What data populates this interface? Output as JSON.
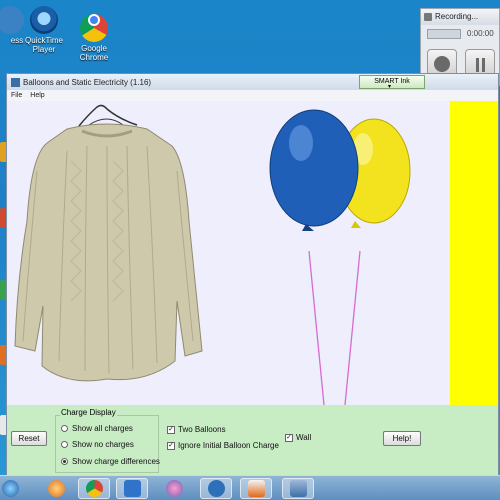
{
  "desktop": {
    "icons": [
      {
        "label_line1": "ess",
        "label_line2": "",
        "icon": "partial-app-icon"
      },
      {
        "label_line1": "QuickTime",
        "label_line2": "Player",
        "icon": "quicktime-icon"
      },
      {
        "label_line1": "Google",
        "label_line2": "Chrome",
        "icon": "chrome-icon"
      }
    ]
  },
  "window": {
    "title": "Balloons and Static Electricity (1.16)",
    "smart_ink_label": "SMART Ink",
    "menu": [
      "File",
      "Help"
    ]
  },
  "controls": {
    "reset_label": "Reset",
    "charge_display": {
      "title": "Charge Display",
      "options": [
        "Show all charges",
        "Show no charges",
        "Show charge differences"
      ],
      "selected": "Show charge differences"
    },
    "two_balloons": {
      "label": "Two Balloons",
      "checked": true
    },
    "ignore_initial": {
      "label": "Ignore Initial Balloon Charge",
      "checked": true
    },
    "wall": {
      "label": "Wall",
      "checked": true
    },
    "help_label": "Help!"
  },
  "recorder": {
    "title": "Recording...",
    "time": "0:00:00"
  },
  "colors": {
    "balloon_blue": "#1f5fb8",
    "balloon_yellow": "#f2e31e",
    "wall": "#ffff00",
    "control_panel": "#c8ecc4",
    "sim_background": "#eeeefc"
  },
  "taskbar": {
    "items": [
      "start-icon",
      "media-player-icon",
      "chrome-icon",
      "smart-notebook-icon",
      "network-icon",
      "user-group-icon",
      "java-icon",
      "phet-sim-icon"
    ]
  }
}
